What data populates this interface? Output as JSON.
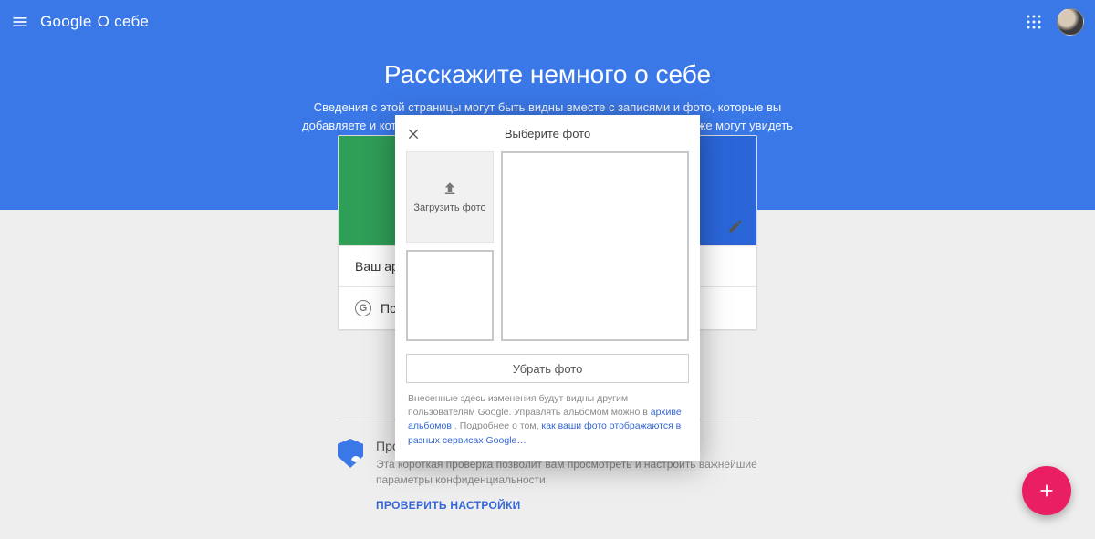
{
  "appbar": {
    "brand_main": "Google",
    "brand_sub": "О себе"
  },
  "hero": {
    "title": "Расскажите немного о себе",
    "subtitle": "Сведения с этой страницы могут быть видны вместе с записями и фото, которые вы добавляете и которыми делитесь. Люди, с которыми вы общаетесь, также могут увидеть ваши"
  },
  "card": {
    "row1": "Ваш арх",
    "row2": "Посм"
  },
  "privacy": {
    "heading": "Про",
    "body": "Эта короткая проверка позволит вам просмотреть и настроить важнейшие параметры конфиденциальности.",
    "cta": "ПРОВЕРИТЬ НАСТРОЙКИ"
  },
  "modal": {
    "title": "Выберите фото",
    "upload_label": "Загрузить фото",
    "remove_label": "Убрать фото",
    "footer_pre": "Внесенные здесь изменения будут видны другим пользователям Google. Управлять альбомом можно в ",
    "footer_link1": "архиве альбомов",
    "footer_mid": ". Подробнее о том, ",
    "footer_link2": "как ваши фото отображаются в разных сервисах Google…"
  }
}
